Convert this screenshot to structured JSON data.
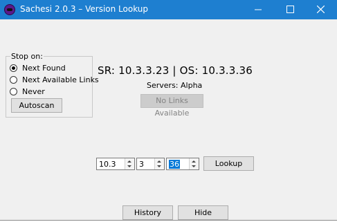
{
  "window": {
    "title": "Sachesi 2.0.3 – Version Lookup",
    "minimize_glyph": "—",
    "maximize_glyph": "☐",
    "close_glyph": "✕"
  },
  "stop_on": {
    "legend": "Stop on:",
    "options": [
      {
        "label": "Next Found",
        "checked": true
      },
      {
        "label": "Next Available Links",
        "checked": false
      },
      {
        "label": "Never",
        "checked": false
      }
    ],
    "autoscan_label": "Autoscan"
  },
  "result": {
    "version_text": "SR: 10.3.3.23 | OS: 10.3.3.36",
    "servers_text": "Servers: Alpha",
    "links_button_label": "No Links Available"
  },
  "lookup": {
    "field1_value": "10.3",
    "field2_value": "3",
    "field3_value": "36",
    "lookup_label": "Lookup"
  },
  "footer": {
    "history_label": "History",
    "hide_label": "Hide"
  },
  "colors": {
    "titlebar": "#1e7fd0",
    "selection": "#0078d7"
  }
}
